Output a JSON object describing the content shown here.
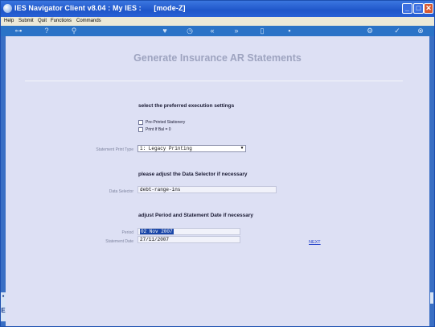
{
  "window": {
    "title": "IES Navigator Client v8.04 : My IES :      [mode-Z]",
    "controls": {
      "minimize": "_",
      "maximize": "□",
      "close": "✕"
    }
  },
  "menu": [
    "Help",
    "Submit",
    "Quit",
    "Functions",
    "Commands"
  ],
  "toolbar": {
    "icons": [
      "key-icon",
      "help-icon",
      "search-icon",
      "heart-icon",
      "history-icon",
      "rewind-icon",
      "fast-forward-icon",
      "book-icon",
      "home-icon",
      "settings-icon",
      "confirm-icon",
      "cancel-icon"
    ]
  },
  "page": {
    "title": "Generate Insurance AR Statements"
  },
  "execution": {
    "heading": "select the preferred execution settings",
    "options": [
      {
        "label": "Pre-Printed Stationery",
        "checked": false
      },
      {
        "label": "Print If Bal = 0",
        "checked": false
      }
    ],
    "print_type_label": "Statement Print Type",
    "print_type_value": "1: Legacy Printing"
  },
  "selector": {
    "heading": "please adjust the Data Selector if necessary",
    "label": "Data Selector",
    "value": "debt-range-ins"
  },
  "period": {
    "heading": "adjust Period and Statement Date if necessary",
    "period_label": "Period",
    "period_value": "02 Nov 2007",
    "date_label": "Statement Date",
    "date_value": "27/11/2007",
    "next_label": "NEXT"
  },
  "colors": {
    "titlebar": "#1f56c9",
    "toolbar": "#2b73c7",
    "content_bg": "#dde0f4",
    "link": "#2240c8"
  }
}
